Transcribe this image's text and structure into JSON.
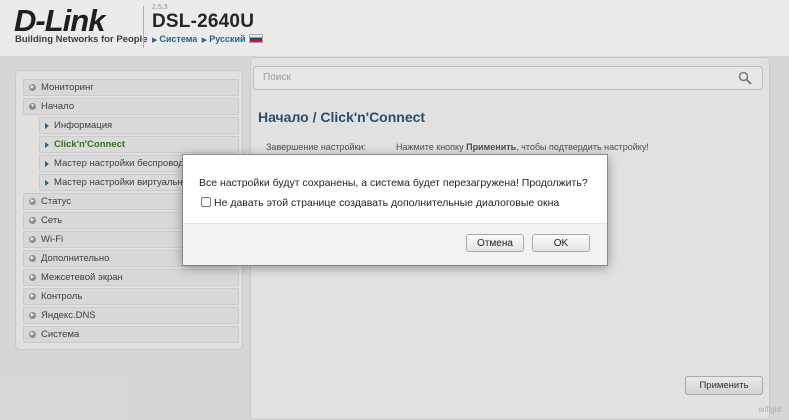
{
  "header": {
    "logo": "D-Link",
    "slogan": "Building Networks for People",
    "firmware": "2.5.3",
    "model": "DSL-2640U",
    "crumb_system": "Система",
    "crumb_language": "Русский"
  },
  "menu": {
    "items": [
      {
        "label": "Мониторинг",
        "level": 0
      },
      {
        "label": "Начало",
        "level": 0,
        "expanded": true
      },
      {
        "label": "Информация",
        "level": 1
      },
      {
        "label": "Click'n'Connect",
        "level": 1,
        "active": true
      },
      {
        "label": "Мастер настройки беспроводной",
        "level": 1
      },
      {
        "label": "Мастер настройки виртуального",
        "level": 1
      },
      {
        "label": "Статус",
        "level": 0
      },
      {
        "label": "Сеть",
        "level": 0
      },
      {
        "label": "Wi-Fi",
        "level": 0
      },
      {
        "label": "Дополнительно",
        "level": 0
      },
      {
        "label": "Межсетевой экран",
        "level": 0
      },
      {
        "label": "Контроль",
        "level": 0
      },
      {
        "label": "Яндекс.DNS",
        "level": 0
      },
      {
        "label": "Система",
        "level": 0
      }
    ]
  },
  "search": {
    "placeholder": "Поиск"
  },
  "content": {
    "title": "Начало /  Click'n'Connect",
    "row_label": "Завершение настройки:",
    "row_value_pre": "Нажмите кнопку ",
    "row_value_bold": "Применить",
    "row_value_post": ", чтобы подтвердить настройку!",
    "apply_label": "Применить"
  },
  "dialog": {
    "message": "Все настройки будут сохранены, а система будет перезагружена! Продолжить?",
    "checkbox_label": "Не давать этой странице создавать дополнительные диалоговые окна",
    "cancel_label": "Отмена",
    "ok_label": "OK"
  },
  "watermark": "wifigid"
}
